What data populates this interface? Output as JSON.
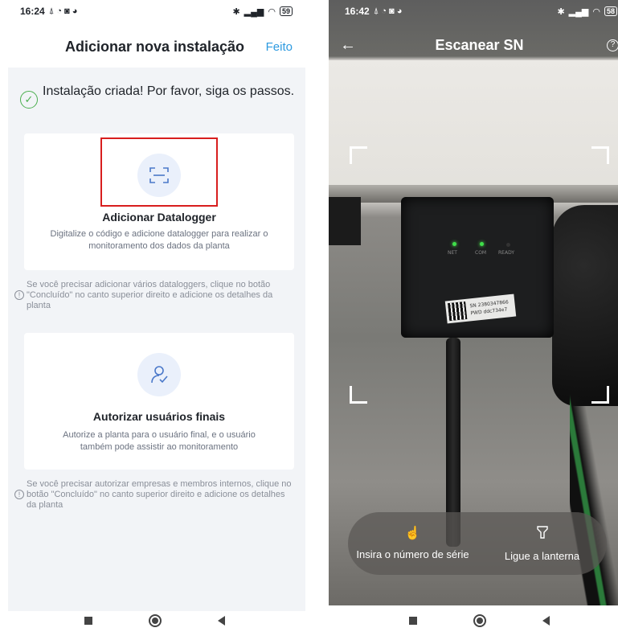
{
  "left_screen": {
    "status": {
      "time": "16:24",
      "icons": "⍋ ◔ ◙ ◕",
      "battery": "59"
    },
    "header": {
      "title": "Adicionar nova instalação",
      "done_label": "Feito"
    },
    "success": {
      "text": "Instalação criada! Por favor, siga os passos."
    },
    "datalogger_card": {
      "title": "Adicionar Datalogger",
      "description": "Digitalize o código e adicione datalogger para realizar o monitoramento dos dados da planta",
      "icon": "scan-icon"
    },
    "note1": "Se você precisar adicionar vários dataloggers, clique no botão \"Concluído\" no canto superior direito e adicione os detalhes da planta",
    "users_card": {
      "title": "Autorizar usuários finais",
      "description": "Autorize a planta para o usuário final, e o usuário também pode assistir ao monitoramento",
      "icon": "user-check-icon"
    },
    "note2": "Se você precisar autorizar empresas e membros internos, clique no botão \"Concluído\" no canto superior direito e adicione os detalhes da planta"
  },
  "right_screen": {
    "status": {
      "time": "16:42",
      "icons": "⍋ ◔ ◙ ◕",
      "battery": "58"
    },
    "header": {
      "title": "Escanear SN"
    },
    "device_labels": {
      "net": "NET",
      "com": "COM",
      "ready": "READY",
      "sn": "SN 2380347866",
      "pwd": "PWD ddc734e7"
    },
    "toolbar": {
      "serial_label": "Insira o número de série",
      "flashlight_label": "Ligue a lanterna"
    }
  },
  "colors": {
    "accent": "#2d9ae0",
    "highlight": "#d81e1e",
    "success": "#4caf50"
  }
}
